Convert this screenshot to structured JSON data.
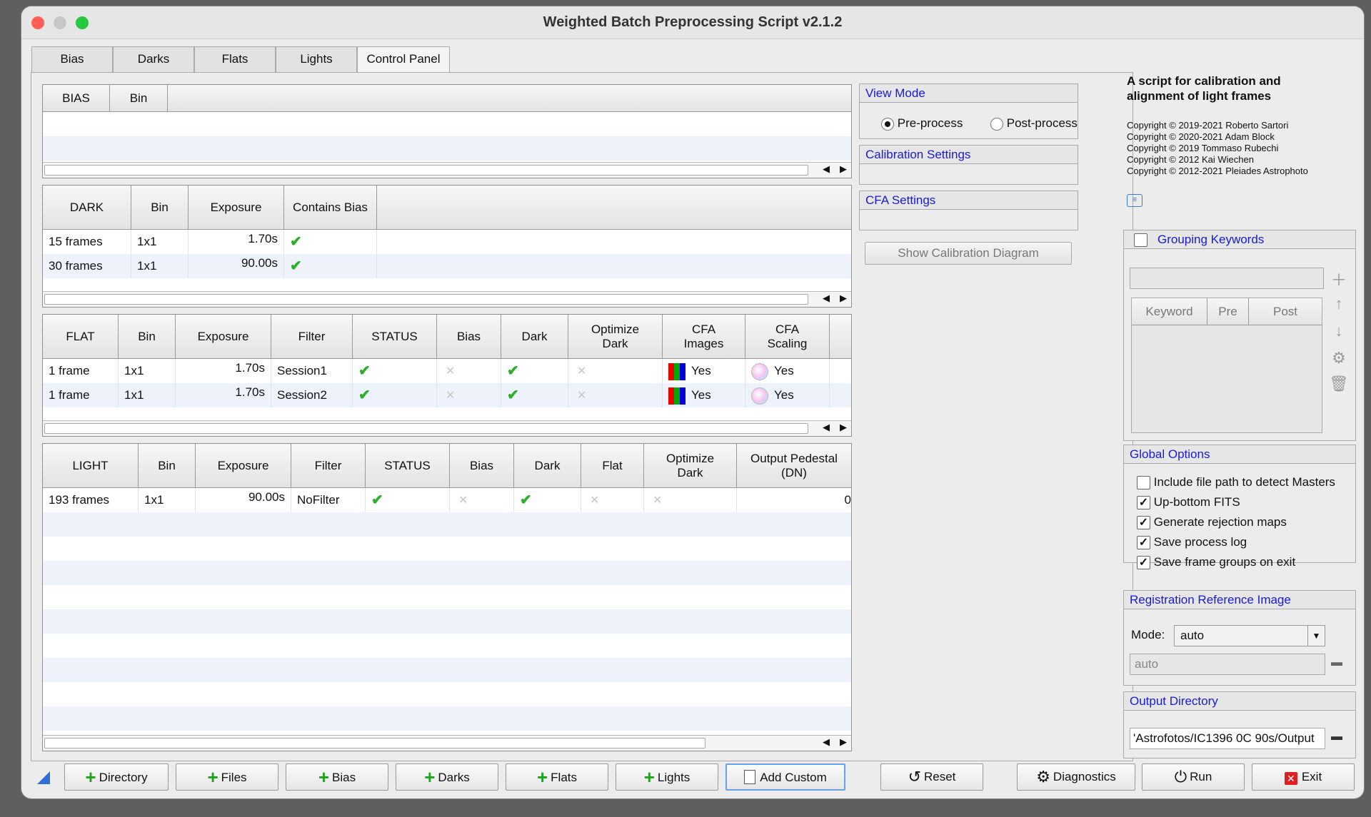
{
  "window": {
    "title": "Weighted Batch Preprocessing Script v2.1.2"
  },
  "tabs": [
    "Bias",
    "Darks",
    "Flats",
    "Lights",
    "Control Panel"
  ],
  "bias_table": {
    "headers": [
      "BIAS",
      "Bin"
    ]
  },
  "dark_table": {
    "headers": [
      "DARK",
      "Bin",
      "Exposure",
      "Contains Bias"
    ],
    "rows": [
      {
        "frames": "15 frames",
        "bin": "1x1",
        "exposure": "1.70s"
      },
      {
        "frames": "30 frames",
        "bin": "1x1",
        "exposure": "90.00s"
      }
    ]
  },
  "flat_table": {
    "headers": [
      "FLAT",
      "Bin",
      "Exposure",
      "Filter",
      "STATUS",
      "Bias",
      "Dark",
      "Optimize Dark",
      "CFA Images",
      "CFA Scaling"
    ],
    "rows": [
      {
        "frames": "1 frame",
        "bin": "1x1",
        "exposure": "1.70s",
        "filter": "Session1",
        "cfa_images": "Yes",
        "cfa_scaling": "Yes"
      },
      {
        "frames": "1 frame",
        "bin": "1x1",
        "exposure": "1.70s",
        "filter": "Session2",
        "cfa_images": "Yes",
        "cfa_scaling": "Yes"
      }
    ]
  },
  "light_table": {
    "headers": [
      "LIGHT",
      "Bin",
      "Exposure",
      "Filter",
      "STATUS",
      "Bias",
      "Dark",
      "Flat",
      "Optimize Dark",
      "Output Pedestal (DN)"
    ],
    "rows": [
      {
        "frames": "193 frames",
        "bin": "1x1",
        "exposure": "90.00s",
        "filter": "NoFilter",
        "pedestal": "0"
      }
    ]
  },
  "view_mode": {
    "title": "View Mode",
    "options": [
      "Pre-process",
      "Post-process"
    ],
    "selected": "Pre-process"
  },
  "calibration_settings": {
    "title": "Calibration Settings"
  },
  "cfa_settings": {
    "title": "CFA Settings"
  },
  "show_diagram_button": "Show Calibration Diagram",
  "about": {
    "title": "A script for calibration and alignment of light frames",
    "copyrights": [
      "Copyright © 2019-2021 Roberto Sartori",
      "Copyright © 2020-2021 Adam Block",
      "Copyright © 2019 Tommaso Rubechi",
      "Copyright © 2012 Kai Wiechen",
      "Copyright © 2012-2021 Pleiades Astrophoto"
    ]
  },
  "grouping": {
    "title": "Grouping Keywords",
    "checked": false,
    "columns": [
      "Keyword",
      "Pre",
      "Post"
    ]
  },
  "global_options": {
    "title": "Global Options",
    "items": [
      {
        "label": "Include file path to detect Masters",
        "checked": false
      },
      {
        "label": "Up-bottom FITS",
        "checked": true
      },
      {
        "label": "Generate rejection maps",
        "checked": true
      },
      {
        "label": "Save process log",
        "checked": true
      },
      {
        "label": "Save frame groups on exit",
        "checked": true
      }
    ]
  },
  "registration": {
    "title": "Registration Reference Image",
    "mode_label": "Mode:",
    "mode_value": "auto",
    "path_placeholder": "auto"
  },
  "output_directory": {
    "title": "Output Directory",
    "value": "'Astrofotos/IC1396 0C 90s/Output"
  },
  "bottom_buttons": {
    "directory": "Directory",
    "files": "Files",
    "bias": "Bias",
    "darks": "Darks",
    "flats": "Flats",
    "lights": "Lights",
    "add_custom": "Add Custom",
    "reset": "Reset",
    "diagnostics": "Diagnostics",
    "run": "Run",
    "exit": "Exit"
  },
  "colors": {
    "accent_text": "#1a1ad6",
    "check_green": "#2dae2d",
    "exit_red": "#e02020"
  }
}
